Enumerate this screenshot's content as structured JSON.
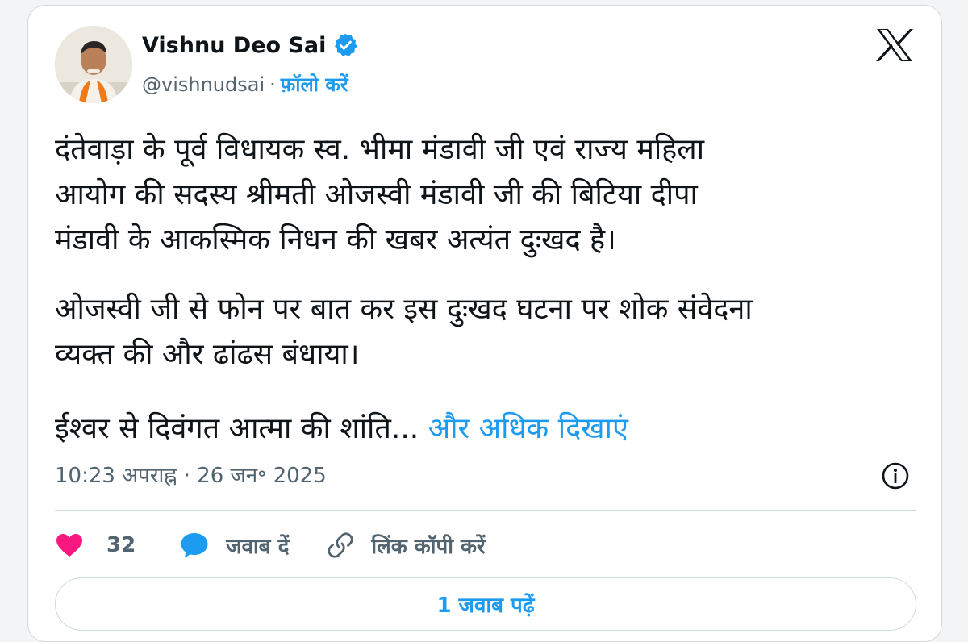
{
  "author": {
    "name": "Vishnu Deo Sai",
    "handle": "@vishnudsai",
    "separator": "·",
    "follow_label": "फ़ॉलो करें"
  },
  "icons": {
    "avatar": "avatar-photo",
    "verified": "verified-badge-icon",
    "logo": "x-logo-icon",
    "info": "info-icon",
    "like": "heart-icon",
    "reply": "speech-bubble-icon",
    "copy_link": "link-icon"
  },
  "tweet": {
    "lines": [
      "दंतेवाड़ा के पूर्व विधायक स्व. भीमा मंडावी जी एवं राज्य महिला",
      "आयोग की सदस्य श्रीमती ओजस्वी मंडावी जी की बिटिया दीपा",
      "मंडावी के आकस्मिक निधन की खबर अत्यंत दुःखद है।",
      "ओजस्वी जी से फोन पर बात कर इस दुःखद घटना पर शोक संवेदना",
      "व्यक्त की और ढांढस बंधाया।",
      "ईश्वर से दिवंगत आत्मा की शांति..."
    ],
    "show_more": "और अधिक दिखाएं",
    "timestamp": "10:23 अपराह्न · 26 जन॰ 2025"
  },
  "actions": {
    "like_count": "32",
    "reply_label": "जवाब दें",
    "copy_link_label": "लिंक कॉपी करें"
  },
  "read_replies_label": "1 जवाब पढ़ें",
  "colors": {
    "accent": "#1d9bf0",
    "like": "#f91880",
    "text": "#0f1419",
    "muted": "#536471",
    "border": "#cfd9de"
  }
}
